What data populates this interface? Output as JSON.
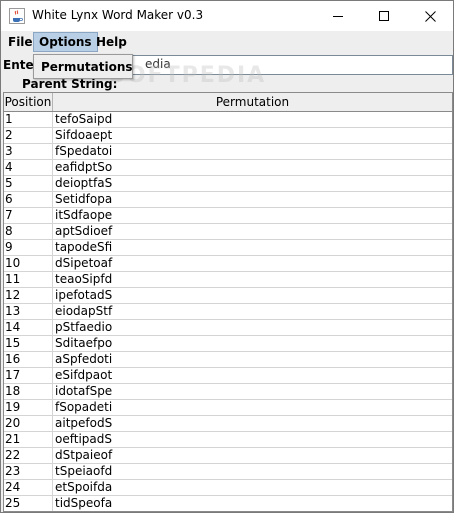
{
  "window": {
    "title": "White Lynx Word Maker v0.3"
  },
  "menubar": {
    "file": "File",
    "options": "Options",
    "help": "Help"
  },
  "options_menu": {
    "items": [
      "Permutations"
    ]
  },
  "form": {
    "enter_label": "Enter",
    "input_value": "edia",
    "parent_label": "Parent String:"
  },
  "watermark": "SOFTPEDIA",
  "table": {
    "headers": {
      "position": "Position",
      "permutation": "Permutation"
    },
    "rows": [
      {
        "position": "1",
        "permutation": "tefoSaipd"
      },
      {
        "position": "2",
        "permutation": "Sifdoaept"
      },
      {
        "position": "3",
        "permutation": "fSpedatoi"
      },
      {
        "position": "4",
        "permutation": "eafidptSo"
      },
      {
        "position": "5",
        "permutation": "deioptfaS"
      },
      {
        "position": "6",
        "permutation": "Setidfopa"
      },
      {
        "position": "7",
        "permutation": "itSdfaope"
      },
      {
        "position": "8",
        "permutation": "aptSdioef"
      },
      {
        "position": "9",
        "permutation": "tapodeSfi"
      },
      {
        "position": "10",
        "permutation": "dSipetoaf"
      },
      {
        "position": "11",
        "permutation": "teaoSipfd"
      },
      {
        "position": "12",
        "permutation": "ipefotadS"
      },
      {
        "position": "13",
        "permutation": "eiodapStf"
      },
      {
        "position": "14",
        "permutation": "pStfaedio"
      },
      {
        "position": "15",
        "permutation": "Sditaefpo"
      },
      {
        "position": "16",
        "permutation": "aSpfedoti"
      },
      {
        "position": "17",
        "permutation": "eSifdpaot"
      },
      {
        "position": "18",
        "permutation": "idotafSpe"
      },
      {
        "position": "19",
        "permutation": "fSopadeti"
      },
      {
        "position": "20",
        "permutation": "aitpefodS"
      },
      {
        "position": "21",
        "permutation": "oeftipadS"
      },
      {
        "position": "22",
        "permutation": "dStpaieof"
      },
      {
        "position": "23",
        "permutation": "tSpeiaofd"
      },
      {
        "position": "24",
        "permutation": "etSpoifda"
      },
      {
        "position": "25",
        "permutation": "tidSpeofa"
      }
    ]
  }
}
